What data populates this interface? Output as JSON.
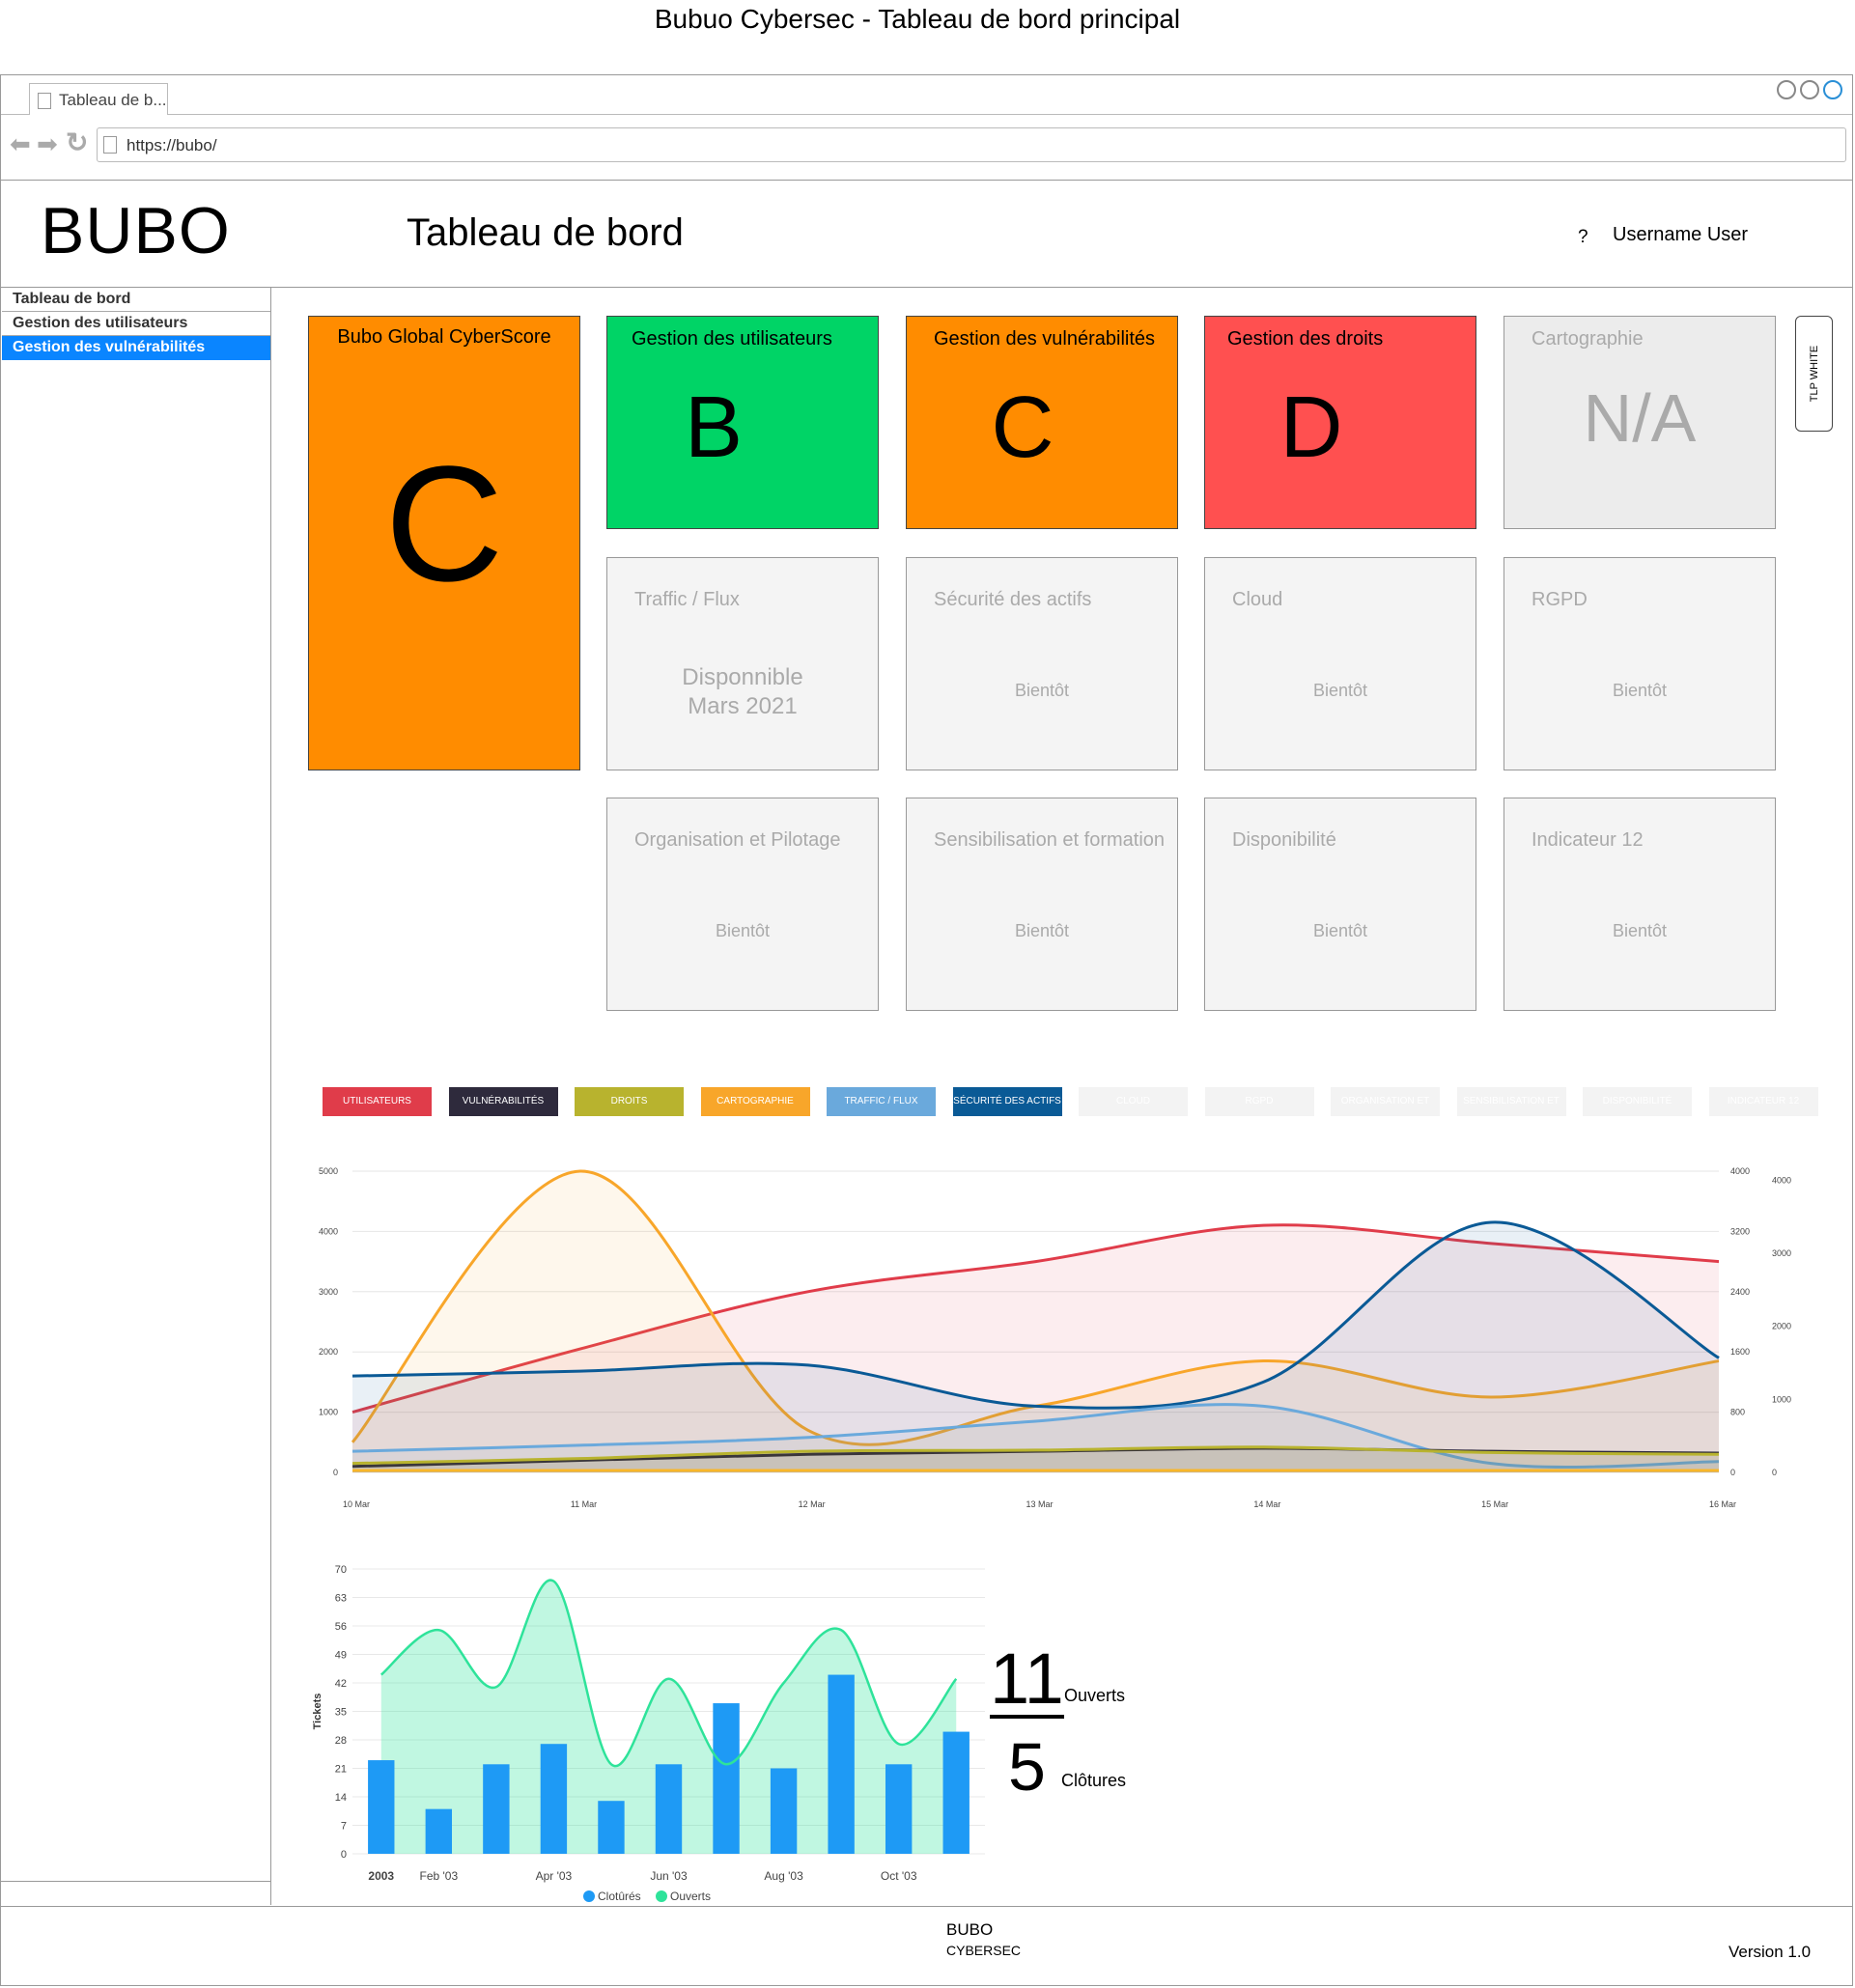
{
  "page_caption": "Bubuo Cybersec - Tableau de bord principal",
  "browser": {
    "tab_label": "Tableau de b...",
    "url": "https://bubo/"
  },
  "header": {
    "logo": "BUBO",
    "title": "Tableau de bord",
    "help": "?",
    "username": "Username User"
  },
  "sidebar": {
    "items": [
      {
        "label": "Tableau de bord",
        "active": false
      },
      {
        "label": "Gestion des utilisateurs",
        "active": false
      },
      {
        "label": "Gestion des vulnérabilités",
        "active": true
      }
    ]
  },
  "tlp_label": "TLP WHITE",
  "score_cards": [
    {
      "title": "Bubo Global CyberScore",
      "value": "C",
      "color": "#ff8c00"
    },
    {
      "title": "Gestion des utilisateurs",
      "value": "B",
      "color": "#00d466"
    },
    {
      "title": "Gestion des vulnérabilités",
      "value": "C",
      "color": "#ff8c00"
    },
    {
      "title": "Gestion des droits",
      "value": "D",
      "color": "#ff5050"
    },
    {
      "title": "Cartographie",
      "value": "N/A",
      "color": "#ececec"
    }
  ],
  "pending_cards": [
    {
      "title": "Traffic / Flux",
      "status_line1": "Disponnible",
      "status_line2": "Mars 2021"
    },
    {
      "title": "Sécurité des actifs",
      "status": "Bientôt"
    },
    {
      "title": "Cloud",
      "status": "Bientôt"
    },
    {
      "title": "RGPD",
      "status": "Bientôt"
    },
    {
      "title": "Organisation et Pilotage",
      "status": "Bientôt"
    },
    {
      "title": "Sensibilisation et formation",
      "status": "Bientôt"
    },
    {
      "title": "Disponibilité",
      "status": "Bientôt"
    },
    {
      "title": "Indicateur 12",
      "status": "Bientôt"
    }
  ],
  "legend_buttons": [
    {
      "label": "Utilisateurs",
      "color": "#e03c4a",
      "active": true
    },
    {
      "label": "Vulnérabilités",
      "color": "#2e2a3c",
      "active": true
    },
    {
      "label": "Droits",
      "color": "#b8b32e",
      "active": true
    },
    {
      "label": "Cartographie",
      "color": "#f8a62a",
      "active": true
    },
    {
      "label": "Traffic / Flux",
      "color": "#6aa9dc",
      "active": true
    },
    {
      "label": "Sécurité des actifs",
      "color": "#0a5a96",
      "active": true
    },
    {
      "label": "Cloud",
      "color": "#f3f3f3",
      "active": false
    },
    {
      "label": "RGPD",
      "color": "#f3f3f3",
      "active": false
    },
    {
      "label": "Organisation et Pilotage",
      "color": "#f3f3f3",
      "active": false
    },
    {
      "label": "Sensibilisation et formation",
      "color": "#f3f3f3",
      "active": false
    },
    {
      "label": "Disponibilité",
      "color": "#f3f3f3",
      "active": false
    },
    {
      "label": "Indicateur 12",
      "color": "#f3f3f3",
      "active": false
    }
  ],
  "chart_data": [
    {
      "type": "area",
      "categories": [
        "10 Mar",
        "11 Mar",
        "12 Mar",
        "13 Mar",
        "14 Mar",
        "15 Mar",
        "16 Mar"
      ],
      "ylim": [
        0,
        5000
      ],
      "yticks": [
        0,
        1000,
        2000,
        3000,
        4000,
        5000
      ],
      "y2ticks": [
        0,
        800,
        1600,
        2400,
        3200,
        4000
      ],
      "y3ticks": [
        0,
        1000,
        2000,
        3000,
        4000
      ],
      "grid": true,
      "series": [
        {
          "name": "Utilisateurs",
          "color": "#e03c4a",
          "values": [
            1000,
            2050,
            3000,
            3500,
            4100,
            3800,
            3500
          ]
        },
        {
          "name": "Cartographie",
          "color": "#f8a62a",
          "values": [
            500,
            5000,
            700,
            1100,
            1850,
            1250,
            1850
          ]
        },
        {
          "name": "Sécurité des actifs",
          "color": "#0a5a96",
          "values": [
            1600,
            1680,
            1780,
            1100,
            1500,
            4150,
            1900
          ]
        },
        {
          "name": "Traffic / Flux",
          "color": "#6aa9dc",
          "values": [
            350,
            450,
            580,
            850,
            1100,
            150,
            180
          ]
        },
        {
          "name": "Vulnérabilités",
          "color": "#2e2a3c",
          "values": [
            100,
            200,
            300,
            350,
            400,
            350,
            320
          ]
        },
        {
          "name": "Droits",
          "color": "#b8b32e",
          "values": [
            150,
            230,
            350,
            370,
            420,
            330,
            300
          ]
        }
      ]
    },
    {
      "type": "bar",
      "ylabel": "Tickets",
      "categories": [
        "2003",
        "Feb '03",
        "",
        "Apr '03",
        "",
        "Jun '03",
        "",
        "Aug '03",
        "",
        "Oct '03",
        ""
      ],
      "ylim": [
        0,
        70
      ],
      "yticks": [
        0,
        7,
        14,
        21,
        28,
        35,
        42,
        49,
        56,
        63,
        70
      ],
      "series": [
        {
          "name": "Clotûrés",
          "color": "#1e9af5",
          "values": [
            23,
            11,
            22,
            27,
            13,
            22,
            37,
            21,
            44,
            22,
            30
          ]
        },
        {
          "name": "Ouverts",
          "color": "#2ee39a",
          "values": [
            44,
            55,
            41,
            67,
            22,
            43,
            22,
            42,
            55,
            27,
            43
          ]
        }
      ]
    }
  ],
  "tickets_summary": {
    "open_count": "11",
    "open_label": "Ouverts",
    "closed_count": "5",
    "closed_label": "Clôtures"
  },
  "footer": {
    "brand": "BUBO",
    "sub": "CYBERSEC",
    "version": "Version 1.0"
  }
}
